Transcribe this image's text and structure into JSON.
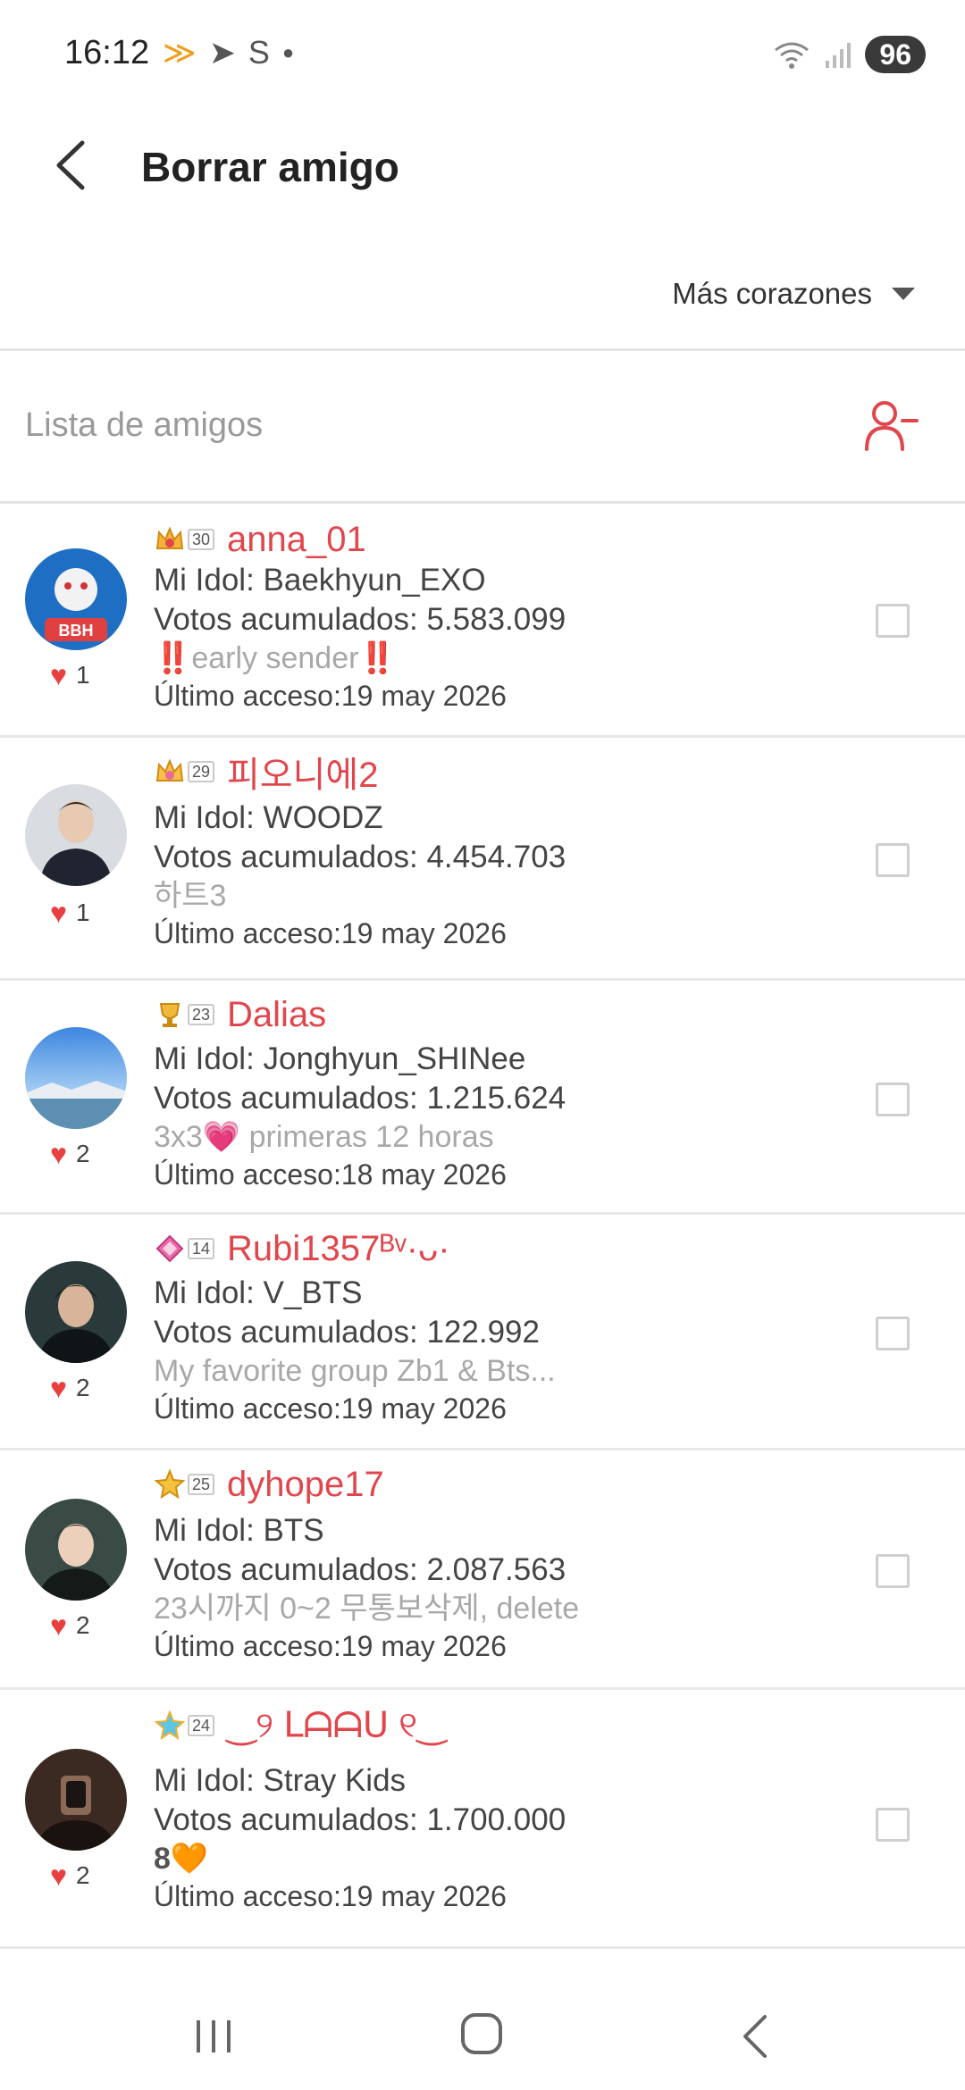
{
  "status_bar": {
    "time": "16:12",
    "app_icons": [
      "notification-icon",
      "telegram-icon",
      "s-icon",
      "dot-icon"
    ],
    "battery": "96"
  },
  "header": {
    "title": "Borrar amigo",
    "sort_label": "Más corazones"
  },
  "list": {
    "title": "Lista de amigos"
  },
  "friends": [
    {
      "level": "30",
      "name": "anna_01",
      "idol": "Mi Idol: Baekhyun_EXO",
      "votes": "Votos acumulados: 5.583.099",
      "status": "‼️early sender‼️",
      "last_access": "Último acceso:19 may 2026",
      "hearts": "1",
      "avatar_color": "#1e6fc4"
    },
    {
      "level": "29",
      "name": "피오니에2",
      "idol": "Mi Idol: WOODZ",
      "votes": "Votos acumulados: 4.454.703",
      "status": "하트3",
      "last_access": "Último acceso:19 may 2026",
      "hearts": "1",
      "avatar_color": "#d9dde2"
    },
    {
      "level": "23",
      "name": "Dalias",
      "idol": "Mi Idol: Jonghyun_SHINee",
      "votes": "Votos acumulados: 1.215.624",
      "status": "3x3💗 primeras 12 horas",
      "last_access": "Último acceso:18 may 2026",
      "hearts": "2",
      "avatar_color": "#5b9ee6"
    },
    {
      "level": "14",
      "name": "Rubi1357ᴮᵛ·ᴗ·",
      "idol": "Mi Idol: V_BTS",
      "votes": "Votos acumulados: 122.992",
      "status": "My favorite group Zb1 & Bts...",
      "last_access": "Último acceso:19 may 2026",
      "hearts": "2",
      "avatar_color": "#2a3a3a"
    },
    {
      "level": "25",
      "name": "dyhope17",
      "idol": "Mi Idol: BTS",
      "votes": "Votos acumulados: 2.087.563",
      "status": "23시까지 0~2 무통보삭제, delete",
      "last_access": "Último acceso:19 may 2026",
      "hearts": "2",
      "avatar_color": "#3a4a44"
    },
    {
      "level": "24",
      "name": "‿୨ ᒪᗩᗩᑌ ୧‿",
      "idol": "Mi Idol: Stray Kids",
      "votes": "Votos acumulados: 1.700.000",
      "status": "8🧡",
      "last_access": "Último acceso:19 may 2026",
      "hearts": "2",
      "avatar_color": "#3b2a22"
    }
  ],
  "colors": {
    "accent": "#e0474d",
    "heart": "#e8403f"
  }
}
